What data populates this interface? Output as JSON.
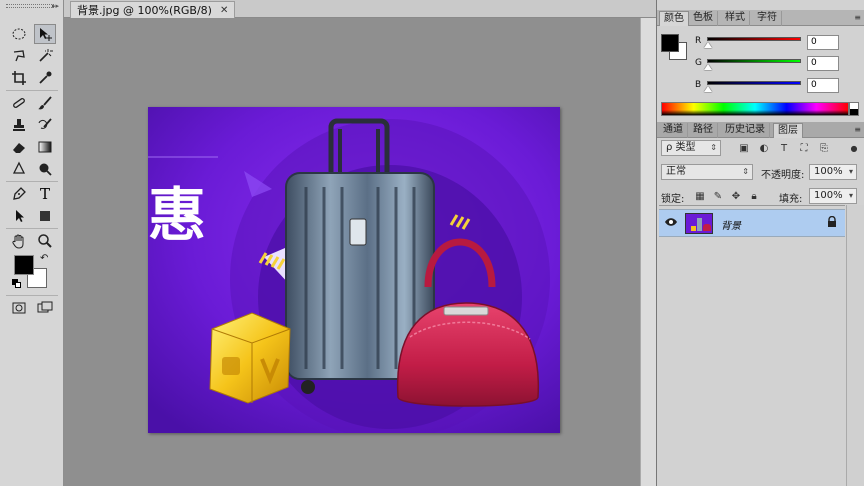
{
  "document": {
    "tab_title": "背景.jpg @ 100%(RGB/8)",
    "close_glyph": "✕",
    "image_text": "惠"
  },
  "tools": [
    {
      "name": "move-tool-icon",
      "active": true
    },
    {
      "name": "marquee-tool-icon"
    },
    {
      "name": "lasso-tool-icon"
    },
    {
      "name": "magic-wand-tool-icon"
    },
    {
      "name": "crop-tool-icon"
    },
    {
      "name": "eyedropper-tool-icon"
    },
    {
      "name": "healing-brush-tool-icon"
    },
    {
      "name": "brush-tool-icon"
    },
    {
      "name": "clone-stamp-tool-icon"
    },
    {
      "name": "history-brush-tool-icon"
    },
    {
      "name": "eraser-tool-icon"
    },
    {
      "name": "gradient-tool-icon"
    },
    {
      "name": "blur-tool-icon"
    },
    {
      "name": "dodge-tool-icon"
    },
    {
      "name": "pen-tool-icon"
    },
    {
      "name": "type-tool-icon"
    },
    {
      "name": "path-selection-tool-icon"
    },
    {
      "name": "shape-tool-icon"
    },
    {
      "name": "hand-tool-icon"
    },
    {
      "name": "zoom-tool-icon"
    }
  ],
  "toolbar": {
    "type_glyph": "T",
    "foreground_color": "#000000",
    "background_color": "#ffffff"
  },
  "color_panel": {
    "tabs": [
      "颜色",
      "色板",
      "样式",
      "字符"
    ],
    "selected_tab": 0,
    "channels": [
      {
        "label": "R",
        "value": "0"
      },
      {
        "label": "G",
        "value": "0"
      },
      {
        "label": "B",
        "value": "0"
      }
    ]
  },
  "layers_panel": {
    "tabs": [
      "通道",
      "路径",
      "历史记录",
      "图层"
    ],
    "selected_tab": 3,
    "filter_kind": "ρ 类型",
    "blend_mode": "正常",
    "opacity_label": "不透明度:",
    "opacity_value": "100%",
    "lock_label": "锁定:",
    "fill_label": "填充:",
    "fill_value": "100%",
    "layers": [
      {
        "name": "背景",
        "visible": true,
        "locked": true
      }
    ]
  },
  "colors": {
    "image_bg": "#6a1bd6",
    "selected_layer": "#aeccf0"
  }
}
